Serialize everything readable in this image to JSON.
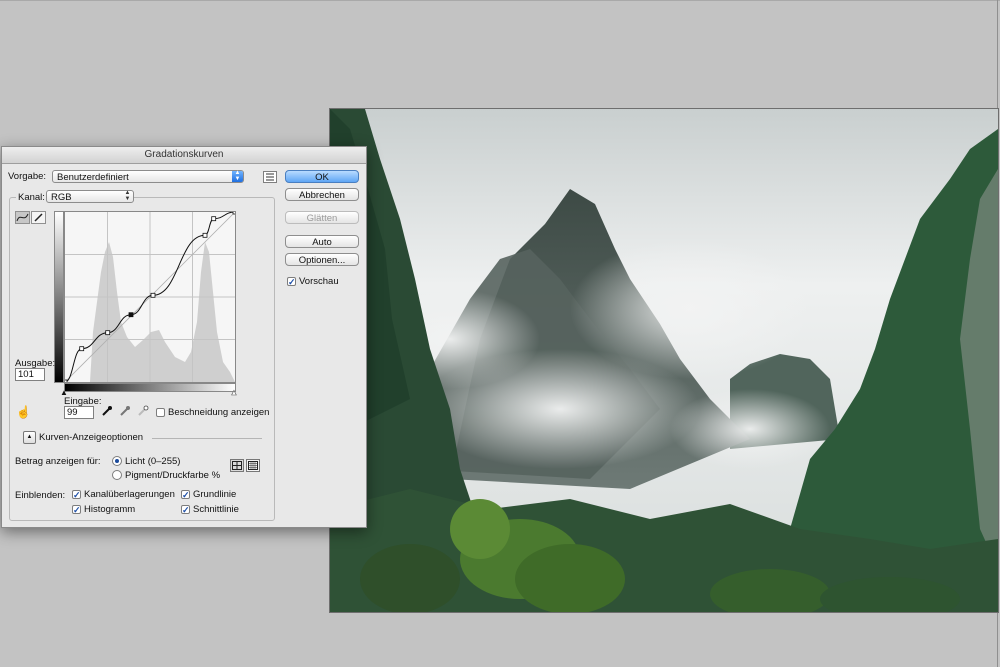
{
  "dialog": {
    "title": "Gradationskurven",
    "preset_label": "Vorgabe:",
    "preset_value": "Benutzerdefiniert",
    "channel_label": "Kanal:",
    "channel_value": "RGB",
    "output_label": "Ausgabe:",
    "output_value": "101",
    "input_label": "Eingabe:",
    "input_value": "99",
    "clipping_label": "Beschneidung anzeigen",
    "clipping_checked": false,
    "curve_options_label": "Kurven-Anzeigeoptionen",
    "show_amount_label": "Betrag anzeigen für:",
    "light_label": "Licht (0–255)",
    "pigment_label": "Pigment/Druckfarbe %",
    "show_label": "Einblenden:",
    "channel_overlays_label": "Kanalüberlagerungen",
    "baseline_label": "Grundlinie",
    "histogram_label": "Histogramm",
    "intersection_label": "Schnittlinie"
  },
  "buttons": {
    "ok": "OK",
    "cancel": "Abbrechen",
    "smooth": "Glätten",
    "auto": "Auto",
    "options": "Optionen...",
    "preview": "Vorschau"
  },
  "curve": {
    "points": [
      [
        0,
        0
      ],
      [
        25,
        50
      ],
      [
        64,
        74
      ],
      [
        99,
        101
      ],
      [
        132,
        130
      ],
      [
        210,
        220
      ],
      [
        223,
        245
      ],
      [
        255,
        255
      ]
    ],
    "max": 255
  },
  "colors": {
    "accent_blue": "#3d86e6",
    "photo_sky": "#e7eaea",
    "photo_forest": "#2f5a3c"
  }
}
